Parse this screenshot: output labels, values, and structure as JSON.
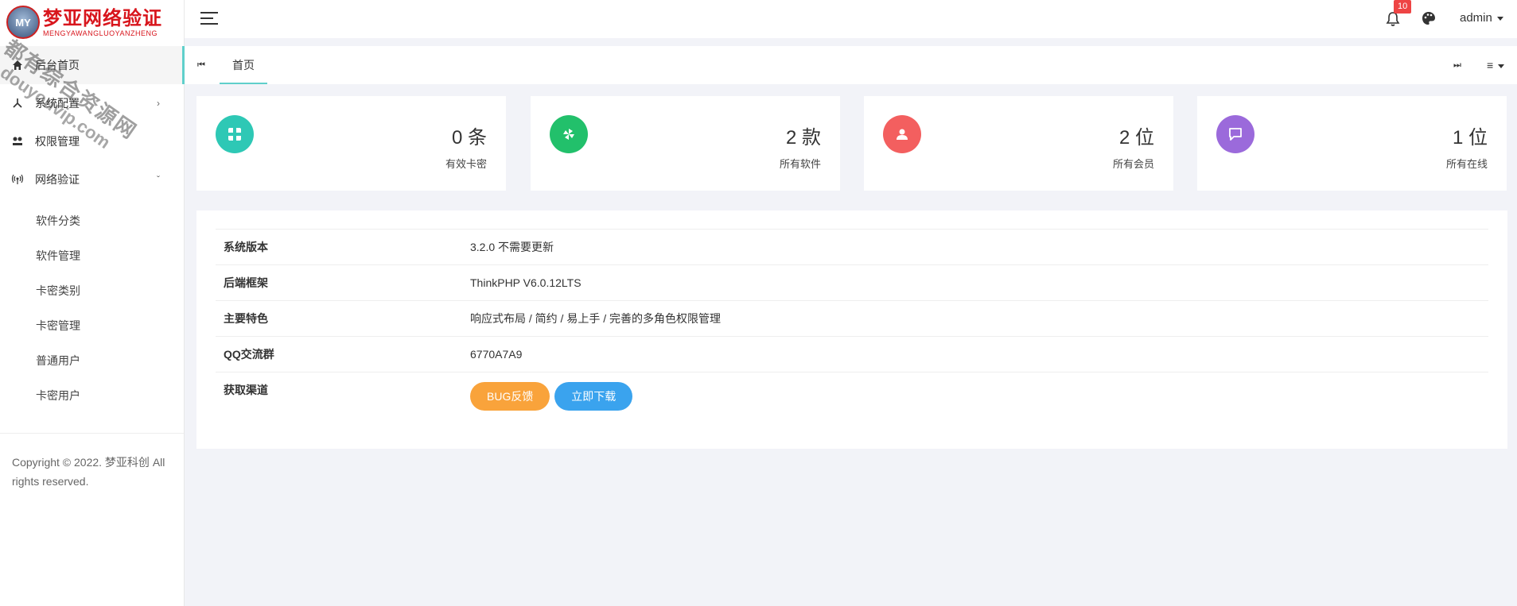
{
  "logo": {
    "badge": "MY",
    "title": "梦亚网络验证",
    "subtitle": "MENGYAWANGLUOYANZHENG"
  },
  "sidebar": {
    "items": [
      {
        "label": "后台首页",
        "icon": "home-icon"
      },
      {
        "label": "系统配置",
        "icon": "settings-fork-icon"
      },
      {
        "label": "权限管理",
        "icon": "permission-icon"
      },
      {
        "label": "网络验证",
        "icon": "wifi-broadcast-icon"
      }
    ],
    "sub_items": [
      {
        "label": "软件分类"
      },
      {
        "label": "软件管理"
      },
      {
        "label": "卡密类别"
      },
      {
        "label": "卡密管理"
      },
      {
        "label": "普通用户"
      },
      {
        "label": "卡密用户"
      }
    ],
    "copyright": "Copyright © 2022. 梦亚科创 All rights reserved."
  },
  "header": {
    "notification_count": "10",
    "user": "admin"
  },
  "tabs": {
    "home": "首页",
    "prev_glyph": "⏮",
    "next_glyph": "⏭",
    "menu_glyph": "≡"
  },
  "stats": [
    {
      "value": "0 条",
      "label": "有效卡密",
      "color": "#2ec8b5",
      "icon": "card-icon"
    },
    {
      "value": "2 款",
      "label": "所有软件",
      "color": "#22c06b",
      "icon": "pinwheel-icon"
    },
    {
      "value": "2 位",
      "label": "所有会员",
      "color": "#f35f5f",
      "icon": "user-icon"
    },
    {
      "value": "1 位",
      "label": "所有在线",
      "color": "#9b6adb",
      "icon": "message-icon"
    }
  ],
  "info": [
    {
      "key": "系统版本",
      "value": "3.2.0 不需要更新"
    },
    {
      "key": "后端框架",
      "value": "ThinkPHP V6.0.12LTS"
    },
    {
      "key": "主要特色",
      "value": "响应式布局 / 简约 / 易上手 / 完善的多角色权限管理"
    },
    {
      "key": "QQ交流群",
      "value": "6770A7A9"
    },
    {
      "key": "获取渠道",
      "value": ""
    }
  ],
  "buttons": {
    "feedback": "BUG反馈",
    "download": "立即下载"
  },
  "watermark": {
    "line1": "都有综合资源网",
    "line2": "douyouvip.com"
  }
}
